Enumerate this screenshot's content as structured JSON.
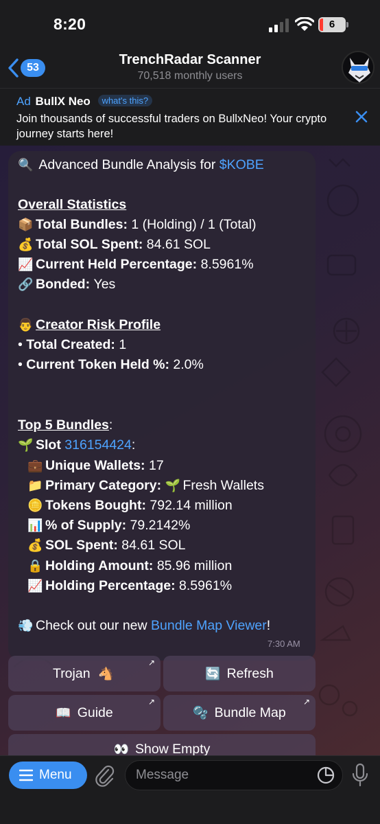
{
  "status_bar": {
    "time": "8:20",
    "battery": "6"
  },
  "header": {
    "back_count": "53",
    "title": "TrenchRadar Scanner",
    "subtitle": "70,518 monthly users"
  },
  "ad": {
    "label": "Ad",
    "name": "BullX Neo",
    "whats_this": "what's this?",
    "text": "Join thousands of successful traders on BullxNeo! Your crypto journey starts here!"
  },
  "message": {
    "heading_prefix": "Advanced Bundle Analysis for",
    "token": "$KOBE",
    "overall_title": "Overall Statistics",
    "stats": [
      {
        "label": "Total Bundles",
        "value": "1 (Holding) / 1 (Total)"
      },
      {
        "label": "Total SOL Spent",
        "value": "84.61 SOL"
      },
      {
        "label": "Current Held Percentage",
        "value": "8.5961%"
      },
      {
        "label": "Bonded",
        "value": "Yes"
      }
    ],
    "creator_title": "Creator Risk Profile",
    "creator": [
      {
        "label": "Total Created",
        "value": "1"
      },
      {
        "label": "Current Token Held %",
        "value": "2.0%"
      }
    ],
    "top_title": "Top 5 Bundles",
    "slot_label": "Slot",
    "slot_value": "316154424",
    "bundle": [
      {
        "label": "Unique Wallets",
        "value": "17"
      },
      {
        "label": "Primary Category",
        "value": "Fresh Wallets"
      },
      {
        "label": "Tokens Bought",
        "value": "792.14 million"
      },
      {
        "label": "% of Supply",
        "value": "79.2142%"
      },
      {
        "label": "SOL Spent",
        "value": "84.61 SOL"
      },
      {
        "label": "Holding Amount",
        "value": "85.96 million"
      },
      {
        "label": "Holding Percentage",
        "value": "8.5961%"
      }
    ],
    "footer_prefix": "Check out our new",
    "footer_link": "Bundle Map Viewer",
    "time": "7:30 AM"
  },
  "buttons": {
    "trojan": "Trojan",
    "refresh": "Refresh",
    "guide": "Guide",
    "bundle_map": "Bundle Map",
    "show_empty": "Show Empty"
  },
  "input": {
    "menu_label": "Menu",
    "placeholder": "Message"
  },
  "icons": [
    "signal-icon",
    "wifi-icon",
    "battery-icon",
    "back-chevron-icon",
    "close-icon",
    "magnifier-icon",
    "package-icon",
    "money-bag-icon",
    "chart-up-icon",
    "link-icon",
    "person-icon",
    "seedling-icon",
    "briefcase-icon",
    "folder-icon",
    "coin-icon",
    "bar-chart-icon",
    "lock-icon",
    "dash-icon",
    "horse-icon",
    "refresh-icon",
    "book-icon",
    "map-icon",
    "eyes-icon",
    "menu-icon",
    "paperclip-icon",
    "sticker-icon",
    "microphone-icon"
  ],
  "colors": {
    "accent": "#3a8ef0",
    "link": "#4ea3ff",
    "bubble": "#2c2534"
  }
}
